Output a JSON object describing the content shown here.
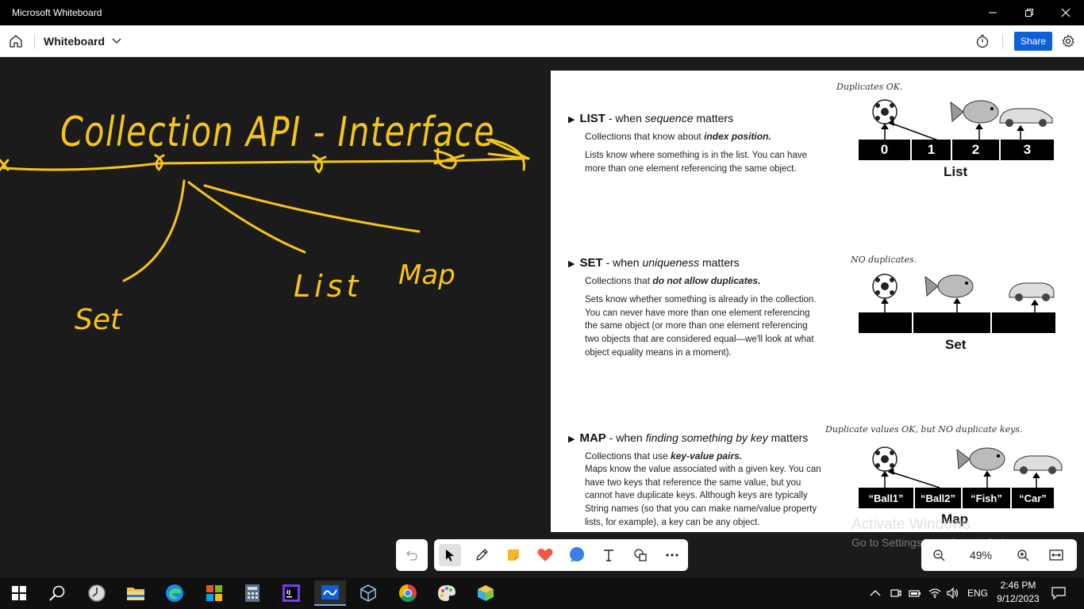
{
  "window": {
    "title": "Microsoft Whiteboard"
  },
  "header": {
    "board_title": "Whiteboard",
    "share_label": "Share"
  },
  "ink": {
    "title": "Collection API - Interface",
    "branch_set": "Set",
    "branch_list": "List",
    "branch_map": "Map"
  },
  "doc": {
    "list": {
      "keyword": "LIST",
      "dash": " - when ",
      "emph": "sequence",
      "tail": " matters",
      "sub_prefix": "Collections that know about ",
      "sub_bold": "index position.",
      "body": "Lists know where something is in the list. You can have more than one element referencing the same object.",
      "note": "Duplicates OK.",
      "cells": [
        "0",
        "1",
        "2",
        "3"
      ],
      "label": "List"
    },
    "set": {
      "keyword": "SET",
      "dash": " - when ",
      "emph": "uniqueness",
      "tail": " matters",
      "sub_prefix": "Collections that ",
      "sub_bold": "do not allow duplicates.",
      "body": "Sets know whether something is already in the collection. You can never have more than one element referencing the same object (or more than one element referencing two objects that are considered equal—we'll look at what object equality means in a moment).",
      "note": "NO duplicates.",
      "label": "Set"
    },
    "map": {
      "keyword": "MAP",
      "dash": " - when ",
      "emph": "finding something by key",
      "tail": " matters",
      "sub_prefix": "Collections that use ",
      "sub_bold": "key-value pairs.",
      "body": "Maps know the value associated with a given key. You can have two keys that reference the same value, but you cannot have duplicate keys. Although keys are typically String names (so that you can make name/value property lists, for example), a key can be any object.",
      "note": "Duplicate values OK, but NO duplicate keys.",
      "cells": [
        "“Ball1”",
        "“Ball2”",
        "“Fish”",
        "“Car”"
      ],
      "label": "Map"
    }
  },
  "watermark": {
    "line1": "Activate Windows",
    "line2": "Go to Settings to activate Windows."
  },
  "zoom": {
    "value": "49%"
  },
  "taskbar": {
    "time": "2:46 PM",
    "date": "9/12/2023",
    "lang": "ENG"
  },
  "colors": {
    "ink": "#f5c518",
    "share": "#0f5fd6",
    "canvas": "#1b1b1b"
  },
  "icons": [
    "home-icon",
    "chevron-down-icon",
    "timer-icon",
    "gear-icon",
    "undo-icon",
    "select-icon",
    "pen-icon",
    "sticky-note-icon",
    "reactions-icon",
    "comment-icon",
    "text-icon",
    "shapes-icon",
    "more-icon",
    "zoom-out-icon",
    "zoom-in-icon",
    "fit-icon",
    "windows-start-icon",
    "search-icon"
  ]
}
